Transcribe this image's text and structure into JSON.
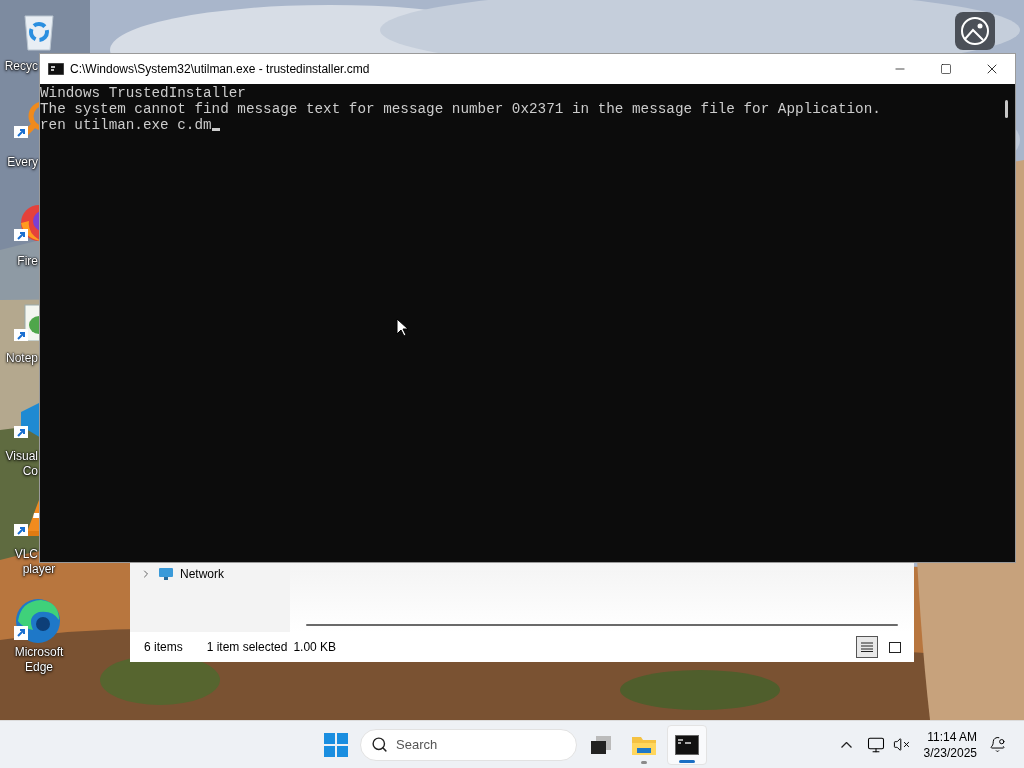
{
  "desktop_icons": [
    {
      "kind": "recycle-bin",
      "label": [
        "Recyc"
      ]
    },
    {
      "kind": "everything",
      "label": [
        "Every"
      ]
    },
    {
      "kind": "firefox",
      "label": [
        "Fire"
      ]
    },
    {
      "kind": "notepad",
      "label": [
        "Notep"
      ]
    },
    {
      "kind": "vscode",
      "label": [
        "Visual",
        "Co"
      ]
    },
    {
      "kind": "vlc",
      "label": [
        "VLC",
        "player"
      ]
    },
    {
      "kind": "edge",
      "label": [
        "Microsoft",
        "Edge"
      ]
    }
  ],
  "console_window": {
    "title": "C:\\Windows\\System32\\utilman.exe - trustedinstaller.cmd",
    "lines": [
      "Windows TrustedInstaller",
      "The system cannot find message text for message number 0x2371 in the message file for Application.",
      "ren utilman.exe c.dm"
    ]
  },
  "explorer_window": {
    "nav_items": [
      {
        "label": "Network",
        "expanded": false
      }
    ],
    "status_bar": [
      "6 items",
      "1 item selected",
      "1.00 KB"
    ],
    "view_buttons": [
      {
        "kind": "details",
        "selected": true
      },
      {
        "kind": "tiles",
        "selected": false
      }
    ]
  },
  "taskbar": {
    "search": {
      "placeholder": "Search"
    },
    "apps": [
      {
        "kind": "task-view",
        "open": false,
        "active": false
      },
      {
        "kind": "file-explorer",
        "open": true,
        "active": false
      },
      {
        "kind": "terminal",
        "open": true,
        "active": true
      }
    ],
    "clock": {
      "time": "11:14 AM",
      "date": "3/23/2025"
    }
  }
}
